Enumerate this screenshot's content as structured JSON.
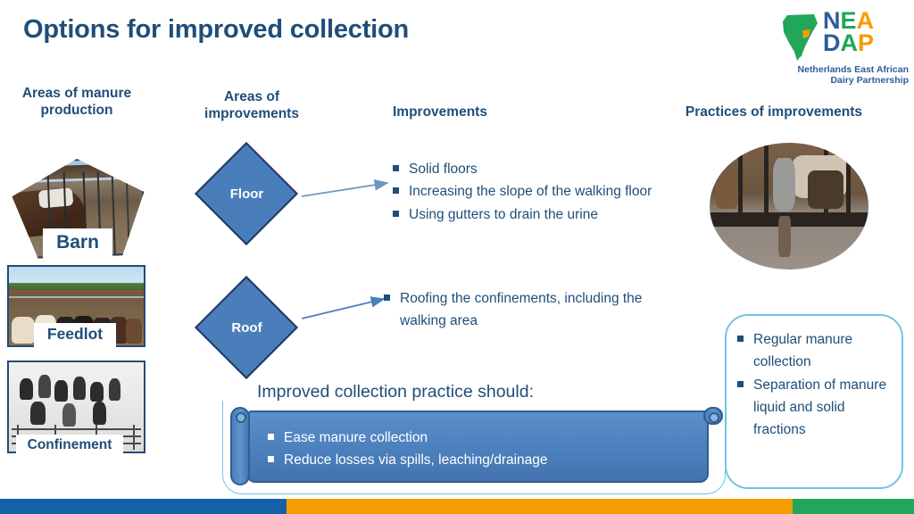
{
  "slide": {
    "title": "Options for improved collection"
  },
  "logo": {
    "letters_row1": [
      "N",
      "E",
      "A"
    ],
    "letters_row2": [
      "D",
      "A",
      "P"
    ],
    "letter_colors_row1": [
      "#2E5C9A",
      "#22A65A",
      "#F59C00"
    ],
    "letter_colors_row2": [
      "#2E5C9A",
      "#22A65A",
      "#F59C00"
    ],
    "tagline_line1": "Netherlands East African",
    "tagline_line2": "Dairy Partnership",
    "africa_color": "#22A65A",
    "africa_accent": "#F59C00",
    "icon": "africa-map-icon"
  },
  "headings": {
    "areas_of_manure_production": "Areas of manure production",
    "areas_of_improvements": "Areas of improvements",
    "improvements": "Improvements",
    "practices_of_improvements": "Practices of improvements"
  },
  "production_areas": [
    {
      "label": "Barn",
      "shape": "pentagon",
      "icon": "barn-photo"
    },
    {
      "label": "Feedlot",
      "shape": "rectangle",
      "icon": "feedlot-photo"
    },
    {
      "label": "Confinement",
      "shape": "rectangle",
      "icon": "confinement-photo"
    }
  ],
  "improvement_areas": [
    {
      "label": "Floor"
    },
    {
      "label": "Roof"
    }
  ],
  "improvements_floor": [
    "Solid floors",
    "Increasing the slope of the walking floor",
    "Using gutters to drain the urine"
  ],
  "improvements_roof": [
    "Roofing the confinements, including the walking area"
  ],
  "practices": [
    "Regular manure collection",
    "Separation of manure liquid and solid fractions"
  ],
  "practice_photo": {
    "icon": "cattle-confinement-photo"
  },
  "scroll": {
    "heading": "Improved collection practice should:",
    "items": [
      "Ease manure collection",
      "Reduce losses via spills, leaching/drainage"
    ]
  },
  "footer_bars": [
    {
      "name": "blue",
      "color": "#1461A8"
    },
    {
      "name": "orange",
      "color": "#F59C00"
    },
    {
      "name": "green",
      "color": "#22A65A"
    }
  ],
  "colors": {
    "title_blue": "#1F4E79",
    "diamond_fill": "#4A7EBB",
    "diamond_border": "#1F3864",
    "scroll_fill": "#4C80BD",
    "light_blue_border": "#6FC4E8"
  }
}
